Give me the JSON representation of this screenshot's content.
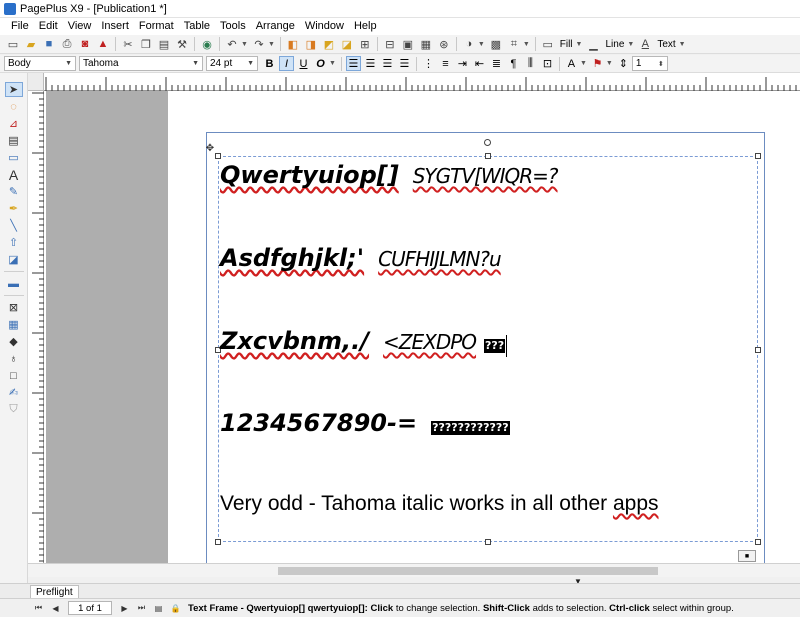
{
  "window": {
    "title": "PagePlus X9 - [Publication1 *]"
  },
  "menu": [
    "File",
    "Edit",
    "View",
    "Insert",
    "Format",
    "Table",
    "Tools",
    "Arrange",
    "Window",
    "Help"
  ],
  "toolbar": {
    "fill_label": "Fill",
    "line_label": "Line",
    "text_label": "Text"
  },
  "format_bar": {
    "style": "Body",
    "font": "Tahoma",
    "size": "24 pt",
    "bold": "B",
    "italic": "I",
    "underline": "U",
    "outline": "O",
    "spacing": "1"
  },
  "document": {
    "lines": [
      {
        "main": "Qwertyuiop[]",
        "tail": "SYGTV[WIQR=?"
      },
      {
        "main": "Asdfghjkl;'",
        "tail": "CUFHIJLMN?u"
      },
      {
        "main": "Zxcvbnm,./",
        "tail": "<ZEXDPO",
        "boxes": "???"
      },
      {
        "main": "1234567890-=",
        "boxes": "????????????"
      }
    ],
    "plain_line": {
      "before": "Very odd - Tahoma italic works in all other ",
      "squiggle": "apps"
    }
  },
  "tabs": [
    "Preflight"
  ],
  "status": {
    "page": "1 of 1",
    "object": "Text Frame - Qwertyuiop[] qwertyuiop[]:",
    "click_key": "Click",
    "click_text": "to change selection.",
    "shift_key": "Shift-Click",
    "shift_text": "adds to selection.",
    "ctrl_key": "Ctrl-click",
    "ctrl_text": "select within group."
  },
  "colors": {
    "frame_border": "#7b9bd4",
    "pasteboard": "#aeaeae",
    "squiggle": "#d02020"
  }
}
